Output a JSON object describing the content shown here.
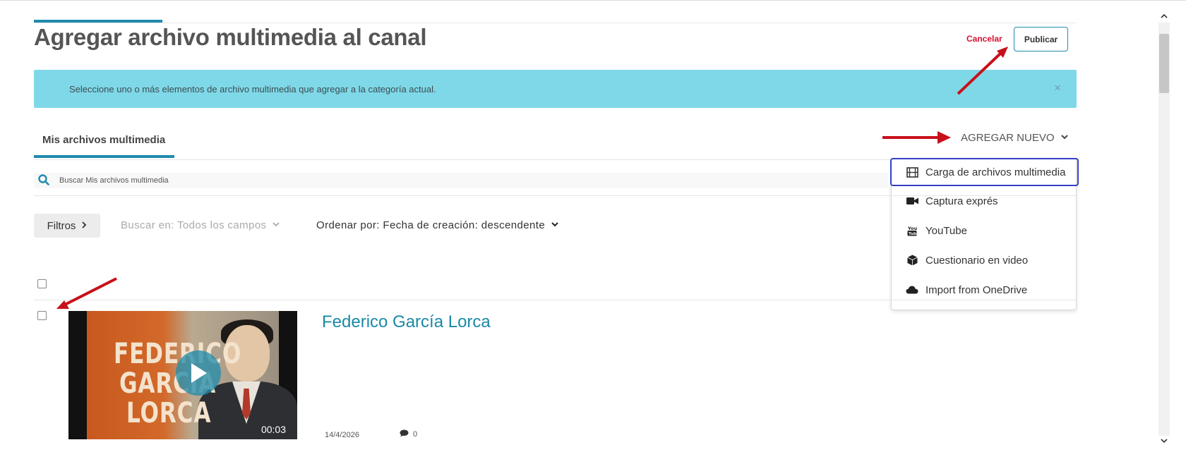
{
  "page": {
    "title": "Agregar archivo multimedia al canal",
    "cancel_label": "Cancelar",
    "publish_label": "Publicar"
  },
  "banner": {
    "message": "Seleccione uno o más elementos de archivo multimedia que agregar a la categoría actual.",
    "close_glyph": "×"
  },
  "tabs": {
    "mine_label": "Mis archivos multimedia"
  },
  "add_new": {
    "label": "AGREGAR NUEVO",
    "items": [
      {
        "label": "Carga de archivos multimedia",
        "icon": "film-icon"
      },
      {
        "label": "Captura exprés",
        "icon": "video-camera-icon"
      },
      {
        "label": "YouTube",
        "icon": "youtube-icon"
      },
      {
        "label": "Cuestionario en video",
        "icon": "cube-icon"
      },
      {
        "label": "Import from OneDrive",
        "icon": "cloud-icon"
      }
    ]
  },
  "search": {
    "placeholder": "Buscar Mis archivos multimedia"
  },
  "toolbar": {
    "filters_label": "Filtros",
    "search_in_label": "Buscar en: Todos los campos",
    "sort_label": "Ordenar por: Fecha de creación: descendente"
  },
  "entries": [
    {
      "title": "Federico García Lorca",
      "thumb_text": [
        "FEDERICO",
        "GARCIA",
        "LORCA"
      ],
      "duration": "00:03",
      "date": "14/4/2026",
      "comments": "0"
    }
  ],
  "colors": {
    "accent": "#1f8bac",
    "banner": "#7fd8e8",
    "cancel": "#d6102f",
    "annotation_arrow": "#c8101a",
    "focus_ring": "#3340c8"
  }
}
